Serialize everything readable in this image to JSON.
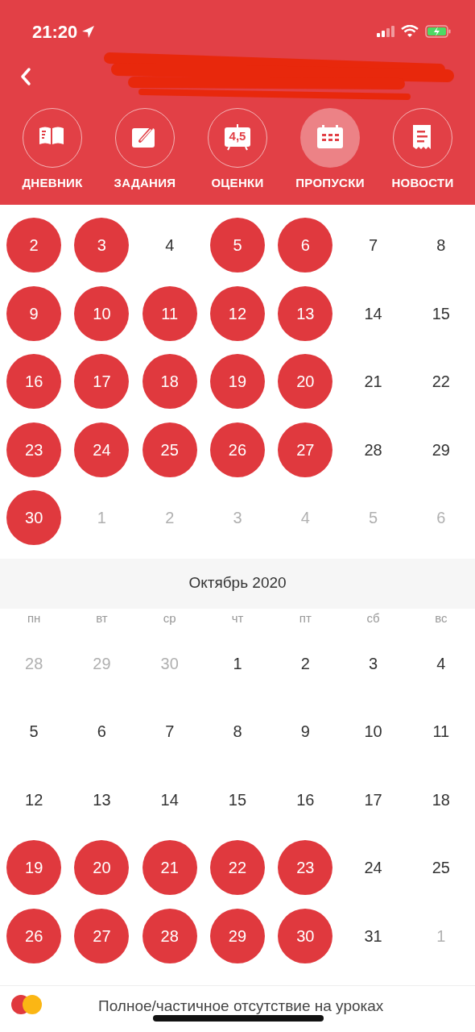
{
  "status_bar": {
    "time": "21:20"
  },
  "nav_tabs": [
    {
      "label": "ДНЕВНИК",
      "selected": false
    },
    {
      "label": "ЗАДАНИЯ",
      "selected": false
    },
    {
      "label": "ОЦЕНКИ",
      "selected": false,
      "icon_text": "4,5"
    },
    {
      "label": "ПРОПУСКИ",
      "selected": true
    },
    {
      "label": "НОВОСТИ",
      "selected": false
    }
  ],
  "months": [
    {
      "weeks": [
        [
          {
            "label": "2",
            "absent": true,
            "outside": false
          },
          {
            "label": "3",
            "absent": true,
            "outside": false
          },
          {
            "label": "4",
            "absent": false,
            "outside": false
          },
          {
            "label": "5",
            "absent": true,
            "outside": false
          },
          {
            "label": "6",
            "absent": true,
            "outside": false
          },
          {
            "label": "7",
            "absent": false,
            "outside": false
          },
          {
            "label": "8",
            "absent": false,
            "outside": false
          }
        ],
        [
          {
            "label": "9",
            "absent": true,
            "outside": false
          },
          {
            "label": "10",
            "absent": true,
            "outside": false
          },
          {
            "label": "11",
            "absent": true,
            "outside": false
          },
          {
            "label": "12",
            "absent": true,
            "outside": false
          },
          {
            "label": "13",
            "absent": true,
            "outside": false
          },
          {
            "label": "14",
            "absent": false,
            "outside": false
          },
          {
            "label": "15",
            "absent": false,
            "outside": false
          }
        ],
        [
          {
            "label": "16",
            "absent": true,
            "outside": false
          },
          {
            "label": "17",
            "absent": true,
            "outside": false
          },
          {
            "label": "18",
            "absent": true,
            "outside": false
          },
          {
            "label": "19",
            "absent": true,
            "outside": false
          },
          {
            "label": "20",
            "absent": true,
            "outside": false
          },
          {
            "label": "21",
            "absent": false,
            "outside": false
          },
          {
            "label": "22",
            "absent": false,
            "outside": false
          }
        ],
        [
          {
            "label": "23",
            "absent": true,
            "outside": false
          },
          {
            "label": "24",
            "absent": true,
            "outside": false
          },
          {
            "label": "25",
            "absent": true,
            "outside": false
          },
          {
            "label": "26",
            "absent": true,
            "outside": false
          },
          {
            "label": "27",
            "absent": true,
            "outside": false
          },
          {
            "label": "28",
            "absent": false,
            "outside": false
          },
          {
            "label": "29",
            "absent": false,
            "outside": false
          }
        ],
        [
          {
            "label": "30",
            "absent": true,
            "outside": false
          },
          {
            "label": "1",
            "absent": false,
            "outside": true
          },
          {
            "label": "2",
            "absent": false,
            "outside": true
          },
          {
            "label": "3",
            "absent": false,
            "outside": true
          },
          {
            "label": "4",
            "absent": false,
            "outside": true
          },
          {
            "label": "5",
            "absent": false,
            "outside": true
          },
          {
            "label": "6",
            "absent": false,
            "outside": true
          }
        ]
      ]
    },
    {
      "title": "Октябрь 2020",
      "weekdays": [
        "пн",
        "вт",
        "ср",
        "чт",
        "пт",
        "сб",
        "вс"
      ],
      "weeks": [
        [
          {
            "label": "28",
            "absent": false,
            "outside": true
          },
          {
            "label": "29",
            "absent": false,
            "outside": true
          },
          {
            "label": "30",
            "absent": false,
            "outside": true
          },
          {
            "label": "1",
            "absent": false,
            "outside": false
          },
          {
            "label": "2",
            "absent": false,
            "outside": false
          },
          {
            "label": "3",
            "absent": false,
            "outside": false
          },
          {
            "label": "4",
            "absent": false,
            "outside": false
          }
        ],
        [
          {
            "label": "5",
            "absent": false,
            "outside": false
          },
          {
            "label": "6",
            "absent": false,
            "outside": false
          },
          {
            "label": "7",
            "absent": false,
            "outside": false
          },
          {
            "label": "8",
            "absent": false,
            "outside": false
          },
          {
            "label": "9",
            "absent": false,
            "outside": false
          },
          {
            "label": "10",
            "absent": false,
            "outside": false
          },
          {
            "label": "11",
            "absent": false,
            "outside": false
          }
        ],
        [
          {
            "label": "12",
            "absent": false,
            "outside": false
          },
          {
            "label": "13",
            "absent": false,
            "outside": false
          },
          {
            "label": "14",
            "absent": false,
            "outside": false
          },
          {
            "label": "15",
            "absent": false,
            "outside": false
          },
          {
            "label": "16",
            "absent": false,
            "outside": false
          },
          {
            "label": "17",
            "absent": false,
            "outside": false
          },
          {
            "label": "18",
            "absent": false,
            "outside": false
          }
        ],
        [
          {
            "label": "19",
            "absent": true,
            "outside": false
          },
          {
            "label": "20",
            "absent": true,
            "outside": false
          },
          {
            "label": "21",
            "absent": true,
            "outside": false
          },
          {
            "label": "22",
            "absent": true,
            "outside": false
          },
          {
            "label": "23",
            "absent": true,
            "outside": false
          },
          {
            "label": "24",
            "absent": false,
            "outside": false
          },
          {
            "label": "25",
            "absent": false,
            "outside": false
          }
        ],
        [
          {
            "label": "26",
            "absent": true,
            "outside": false
          },
          {
            "label": "27",
            "absent": true,
            "outside": false
          },
          {
            "label": "28",
            "absent": true,
            "outside": false
          },
          {
            "label": "29",
            "absent": true,
            "outside": false
          },
          {
            "label": "30",
            "absent": true,
            "outside": false
          },
          {
            "label": "31",
            "absent": false,
            "outside": false
          },
          {
            "label": "1",
            "absent": false,
            "outside": true
          }
        ]
      ]
    }
  ],
  "legend": {
    "markers": [
      {
        "color": "#e0393e"
      },
      {
        "color": "#fbb614"
      }
    ],
    "text": "Полное/частичное отсутствие на уроках"
  }
}
